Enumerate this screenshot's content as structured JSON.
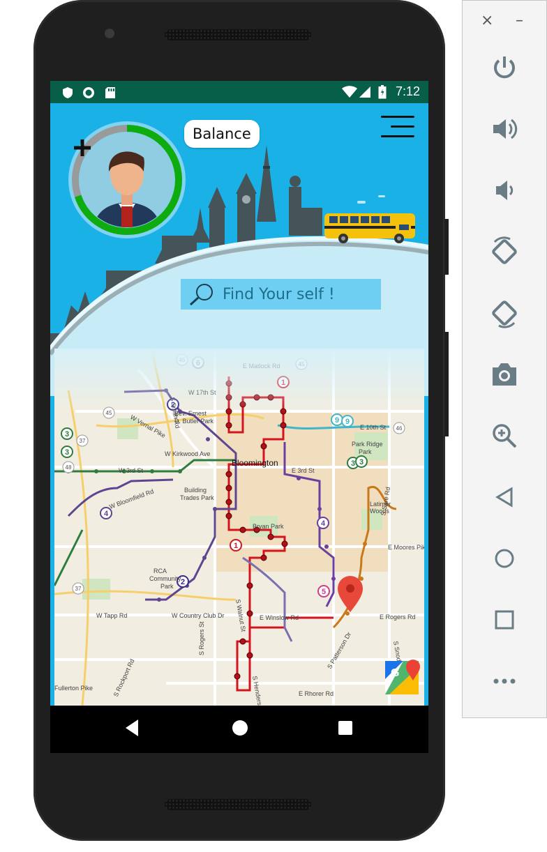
{
  "status_bar": {
    "time": "7:12",
    "icons": [
      "shield-icon",
      "record-icon",
      "sd-card-icon",
      "wifi-icon",
      "signal-icon",
      "battery-icon"
    ]
  },
  "header": {
    "balance_label": "Balance",
    "add_symbol": "+",
    "ring_color": "#0fac0f",
    "sky_color": "#1ab1e6"
  },
  "search": {
    "placeholder": "Find Your self !"
  },
  "map": {
    "streets": [
      "E Matlock Rd",
      "W 17th St",
      "Bev. Ernest",
      "D. Butler Park",
      "W Vernal Pike",
      "W Kirkwood Ave",
      "Bloomington",
      "W 3rd St",
      "Building",
      "Trades Park",
      "W Bloomfield Rd",
      "Bryan Park",
      "E 3rd St",
      "E 10th St",
      "Park Ridge",
      "Park",
      "Latimer",
      "Woods",
      "E Moores Pike",
      "RCA",
      "Community",
      "Park",
      "W Tapp Rd",
      "W Country Club Dr",
      "E Winslow Rd",
      "E Rogers Rd",
      "S Rogers St",
      "S Rockport Rd",
      "S Walnut St",
      "S Sare Rd",
      "S Snoddy Rd",
      "E Rhorer Rd",
      "Fullerton Pike",
      "S Patterson Dr",
      "S Henderson St",
      "S Smith Rd"
    ],
    "route_numbers": [
      "6",
      "1",
      "2",
      "3",
      "3",
      "9",
      "9",
      "3",
      "3",
      "4",
      "4",
      "1",
      "5",
      "2"
    ],
    "highway_shields": [
      "45",
      "45",
      "37",
      "37",
      "48",
      "37",
      "46"
    ],
    "brand": "google-maps-icon"
  },
  "nav": {
    "back": "back-icon",
    "home": "home-icon",
    "recents": "recents-icon"
  },
  "emulator_toolbar": {
    "close": "×",
    "minimize": "–",
    "items": [
      "power-icon",
      "volume-up-icon",
      "volume-down-icon",
      "rotate-left-icon",
      "rotate-right-icon",
      "camera-icon",
      "zoom-icon",
      "back-icon",
      "home-icon",
      "overview-icon",
      "more-icon"
    ]
  }
}
